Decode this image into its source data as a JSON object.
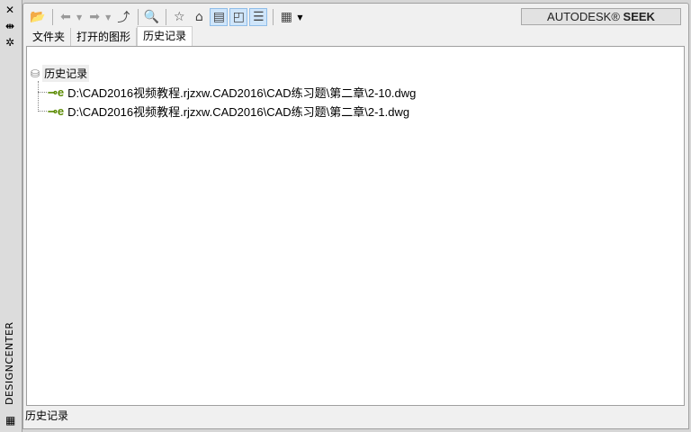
{
  "sidebar": {
    "title": "DESIGNCENTER",
    "icons": [
      "close-icon",
      "autohide-icon",
      "properties-icon",
      "grid-icon"
    ]
  },
  "toolbar": {
    "buttons": [
      "load-icon",
      "back-icon",
      "forward-icon",
      "up-icon",
      "search-icon",
      "favorites-icon",
      "home-icon",
      "tree-view-icon",
      "preview-icon",
      "description-icon",
      "views-icon"
    ]
  },
  "seek": {
    "brand": "AUTODESK®",
    "label": "SEEK"
  },
  "tabs": [
    {
      "label": "文件夹"
    },
    {
      "label": "打开的图形"
    },
    {
      "label": "历史记录",
      "active": true
    }
  ],
  "tree": {
    "root": "历史记录",
    "items": [
      "D:\\CAD2016视频教程.rjzxw.CAD2016\\CAD练习题\\第二章\\2-10.dwg",
      "D:\\CAD2016视频教程.rjzxw.CAD2016\\CAD练习题\\第二章\\2-1.dwg"
    ]
  },
  "status": "历史记录"
}
